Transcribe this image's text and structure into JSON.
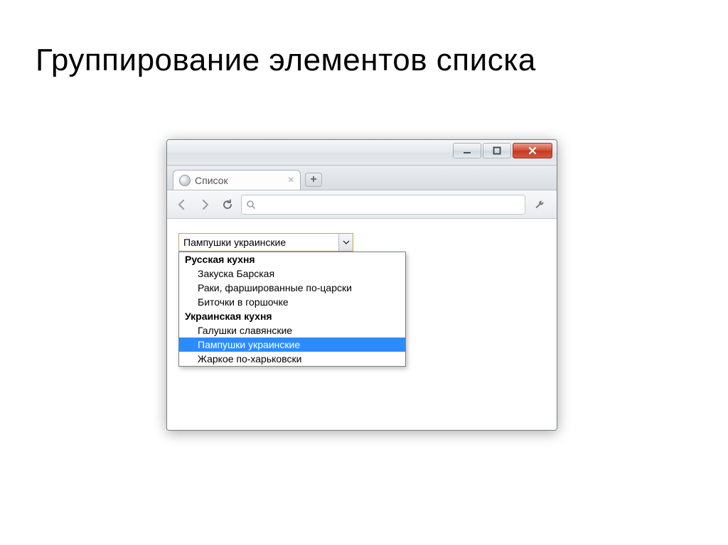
{
  "slide": {
    "title": "Группирование элементов списка"
  },
  "browser": {
    "tab_title": "Список",
    "select_value": "Пампушки украинские",
    "groups": [
      {
        "label": "Русская кухня",
        "options": [
          {
            "text": "Закуска Барская",
            "selected": false
          },
          {
            "text": "Раки, фаршированные по-царски",
            "selected": false
          },
          {
            "text": "Биточки в горшочке",
            "selected": false
          }
        ]
      },
      {
        "label": "Украинская кухня",
        "options": [
          {
            "text": "Галушки славянские",
            "selected": false
          },
          {
            "text": "Пампушки украинские",
            "selected": true
          },
          {
            "text": "Жаркое по-харьковски",
            "selected": false
          }
        ]
      }
    ]
  }
}
